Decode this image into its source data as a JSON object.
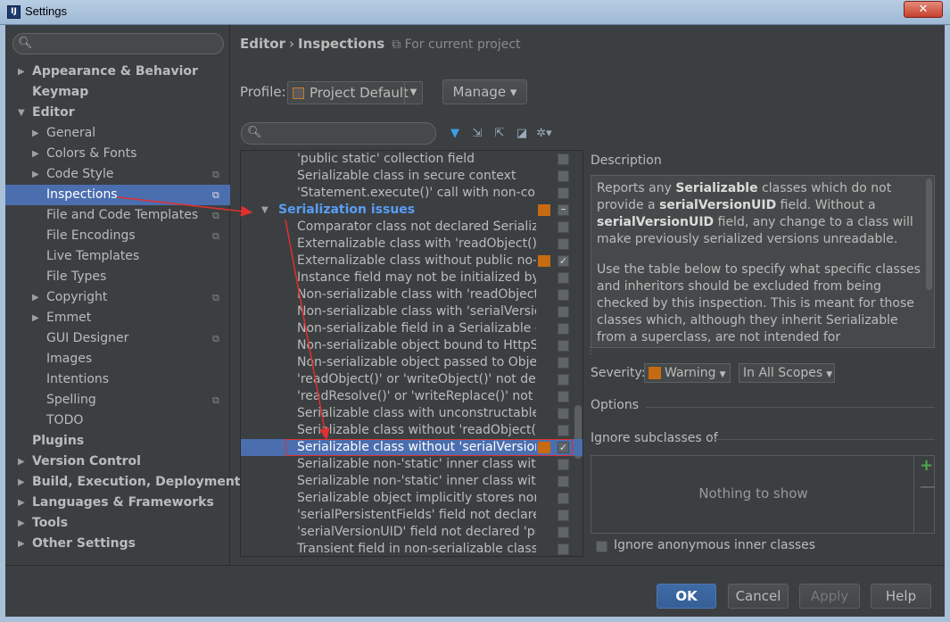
{
  "window": {
    "title": "Settings",
    "app_icon_text": "IJ",
    "close_glyph": "✕"
  },
  "sidebar": {
    "search_placeholder": "",
    "items": [
      {
        "label": "Appearance & Behavior",
        "level": 0,
        "arrow": "▶",
        "bold": true,
        "proj": false
      },
      {
        "label": "Keymap",
        "level": 0,
        "arrow": "",
        "bold": true,
        "proj": false
      },
      {
        "label": "Editor",
        "level": 0,
        "arrow": "▼",
        "bold": true,
        "proj": false
      },
      {
        "label": "General",
        "level": 1,
        "arrow": "▶",
        "bold": false,
        "proj": false
      },
      {
        "label": "Colors & Fonts",
        "level": 1,
        "arrow": "▶",
        "bold": false,
        "proj": false
      },
      {
        "label": "Code Style",
        "level": 1,
        "arrow": "▶",
        "bold": false,
        "proj": true
      },
      {
        "label": "Inspections",
        "level": 1,
        "arrow": "",
        "bold": false,
        "proj": true,
        "selected": true
      },
      {
        "label": "File and Code Templates",
        "level": 1,
        "arrow": "",
        "bold": false,
        "proj": true
      },
      {
        "label": "File Encodings",
        "level": 1,
        "arrow": "",
        "bold": false,
        "proj": true
      },
      {
        "label": "Live Templates",
        "level": 1,
        "arrow": "",
        "bold": false,
        "proj": false
      },
      {
        "label": "File Types",
        "level": 1,
        "arrow": "",
        "bold": false,
        "proj": false
      },
      {
        "label": "Copyright",
        "level": 1,
        "arrow": "▶",
        "bold": false,
        "proj": true
      },
      {
        "label": "Emmet",
        "level": 1,
        "arrow": "▶",
        "bold": false,
        "proj": false
      },
      {
        "label": "GUI Designer",
        "level": 1,
        "arrow": "",
        "bold": false,
        "proj": true
      },
      {
        "label": "Images",
        "level": 1,
        "arrow": "",
        "bold": false,
        "proj": false
      },
      {
        "label": "Intentions",
        "level": 1,
        "arrow": "",
        "bold": false,
        "proj": false
      },
      {
        "label": "Spelling",
        "level": 1,
        "arrow": "",
        "bold": false,
        "proj": true
      },
      {
        "label": "TODO",
        "level": 1,
        "arrow": "",
        "bold": false,
        "proj": false
      },
      {
        "label": "Plugins",
        "level": 0,
        "arrow": "",
        "bold": true,
        "proj": false
      },
      {
        "label": "Version Control",
        "level": 0,
        "arrow": "▶",
        "bold": true,
        "proj": false
      },
      {
        "label": "Build, Execution, Deployment",
        "level": 0,
        "arrow": "▶",
        "bold": true,
        "proj": false
      },
      {
        "label": "Languages & Frameworks",
        "level": 0,
        "arrow": "▶",
        "bold": true,
        "proj": false
      },
      {
        "label": "Tools",
        "level": 0,
        "arrow": "▶",
        "bold": true,
        "proj": false
      },
      {
        "label": "Other Settings",
        "level": 0,
        "arrow": "▶",
        "bold": true,
        "proj": false
      }
    ],
    "proj_icon": "⧉"
  },
  "header": {
    "crumb_editor": "Editor",
    "crumb_sep": "›",
    "crumb_inspections": "Inspections",
    "scope_hint": "For current project",
    "scope_hint_icon": "⧉"
  },
  "profile": {
    "label": "Profile:",
    "value": "Project Default",
    "dropdown_glyph": "▼",
    "manage_label": "Manage ▾"
  },
  "toolbar": {
    "filter_placeholder": "",
    "icons": [
      "filter-icon",
      "expand-all-icon",
      "collapse-all-icon",
      "reset-icon",
      "settings-icon"
    ],
    "glyphs": [
      "▼",
      "⇲",
      "⇱",
      "◪",
      "✲▾"
    ]
  },
  "inspections": [
    {
      "label": "'public static' collection field",
      "sev": false,
      "checked": false
    },
    {
      "label": "Serializable class in secure context",
      "sev": false,
      "checked": false
    },
    {
      "label": "'Statement.execute()' call with non-cons",
      "sev": false,
      "checked": false
    },
    {
      "label": "Serialization issues",
      "group": true,
      "sev": true,
      "checked": "partial"
    },
    {
      "label": "Comparator class not declared Serializab",
      "sev": false,
      "checked": false
    },
    {
      "label": "Externalizable class with 'readObject()' c",
      "sev": false,
      "checked": false
    },
    {
      "label": "Externalizable class without public no-a",
      "sev": true,
      "checked": true
    },
    {
      "label": "Instance field may not be initialized by '",
      "sev": false,
      "checked": false
    },
    {
      "label": "Non-serializable class with 'readObject()",
      "sev": false,
      "checked": false
    },
    {
      "label": "Non-serializable class with 'serialVersion",
      "sev": false,
      "checked": false
    },
    {
      "label": "Non-serializable field in a Serializable cl",
      "sev": false,
      "checked": false
    },
    {
      "label": "Non-serializable object bound to HttpSe",
      "sev": false,
      "checked": false
    },
    {
      "label": "Non-serializable object passed to Objec",
      "sev": false,
      "checked": false
    },
    {
      "label": "'readObject()' or 'writeObject()' not decl",
      "sev": false,
      "checked": false
    },
    {
      "label": "'readResolve()' or 'writeReplace()' not de",
      "sev": false,
      "checked": false
    },
    {
      "label": "Serializable class with unconstructable a",
      "sev": false,
      "checked": false
    },
    {
      "label": "Serializable class without 'readObject()'",
      "sev": false,
      "checked": false
    },
    {
      "label": "Serializable class without 'serialVersionU",
      "sev": true,
      "checked": true,
      "selected": true
    },
    {
      "label": "Serializable non-'static' inner class with",
      "sev": false,
      "checked": false
    },
    {
      "label": "Serializable non-'static' inner class witho",
      "sev": false,
      "checked": false
    },
    {
      "label": "Serializable object implicitly stores non-",
      "sev": false,
      "checked": false
    },
    {
      "label": "'serialPersistentFields' field not declared",
      "sev": false,
      "checked": false
    },
    {
      "label": "'serialVersionUID' field not declared 'pri",
      "sev": false,
      "checked": false
    },
    {
      "label": "Transient field in non-serializable class",
      "sev": false,
      "checked": false
    }
  ],
  "description": {
    "title": "Description",
    "p1_a": "Reports any ",
    "p1_b": "Serializable",
    "p1_c": " classes which do not provide a ",
    "p1_d": "serialVersionUID",
    "p1_e": " field. Without a ",
    "p1_f": "serialVersionUID",
    "p1_g": " field, any change to a class will make previously serialized versions unreadable.",
    "p2": "Use the table below to specify what specific classes and inheritors should be excluded from being checked by this inspection. This is meant for those classes which, although they inherit Serializable from a superclass, are not intended for serialization. Such"
  },
  "severity": {
    "label": "Severity:",
    "value": "Warning",
    "scope": "In All Scopes",
    "color": "#c66b12"
  },
  "options": {
    "title": "Options",
    "ignore_title": "Ignore subclasses of",
    "empty_text": "Nothing to show",
    "add_glyph": "+",
    "remove_glyph": "—",
    "anon_label": "Ignore anonymous inner classes"
  },
  "footer": {
    "ok": "OK",
    "cancel": "Cancel",
    "apply": "Apply",
    "help": "Help"
  },
  "colors": {
    "accent": "#4b6eaf",
    "group_text": "#589df6",
    "annotation": "#e03030",
    "warning": "#c66b12"
  }
}
